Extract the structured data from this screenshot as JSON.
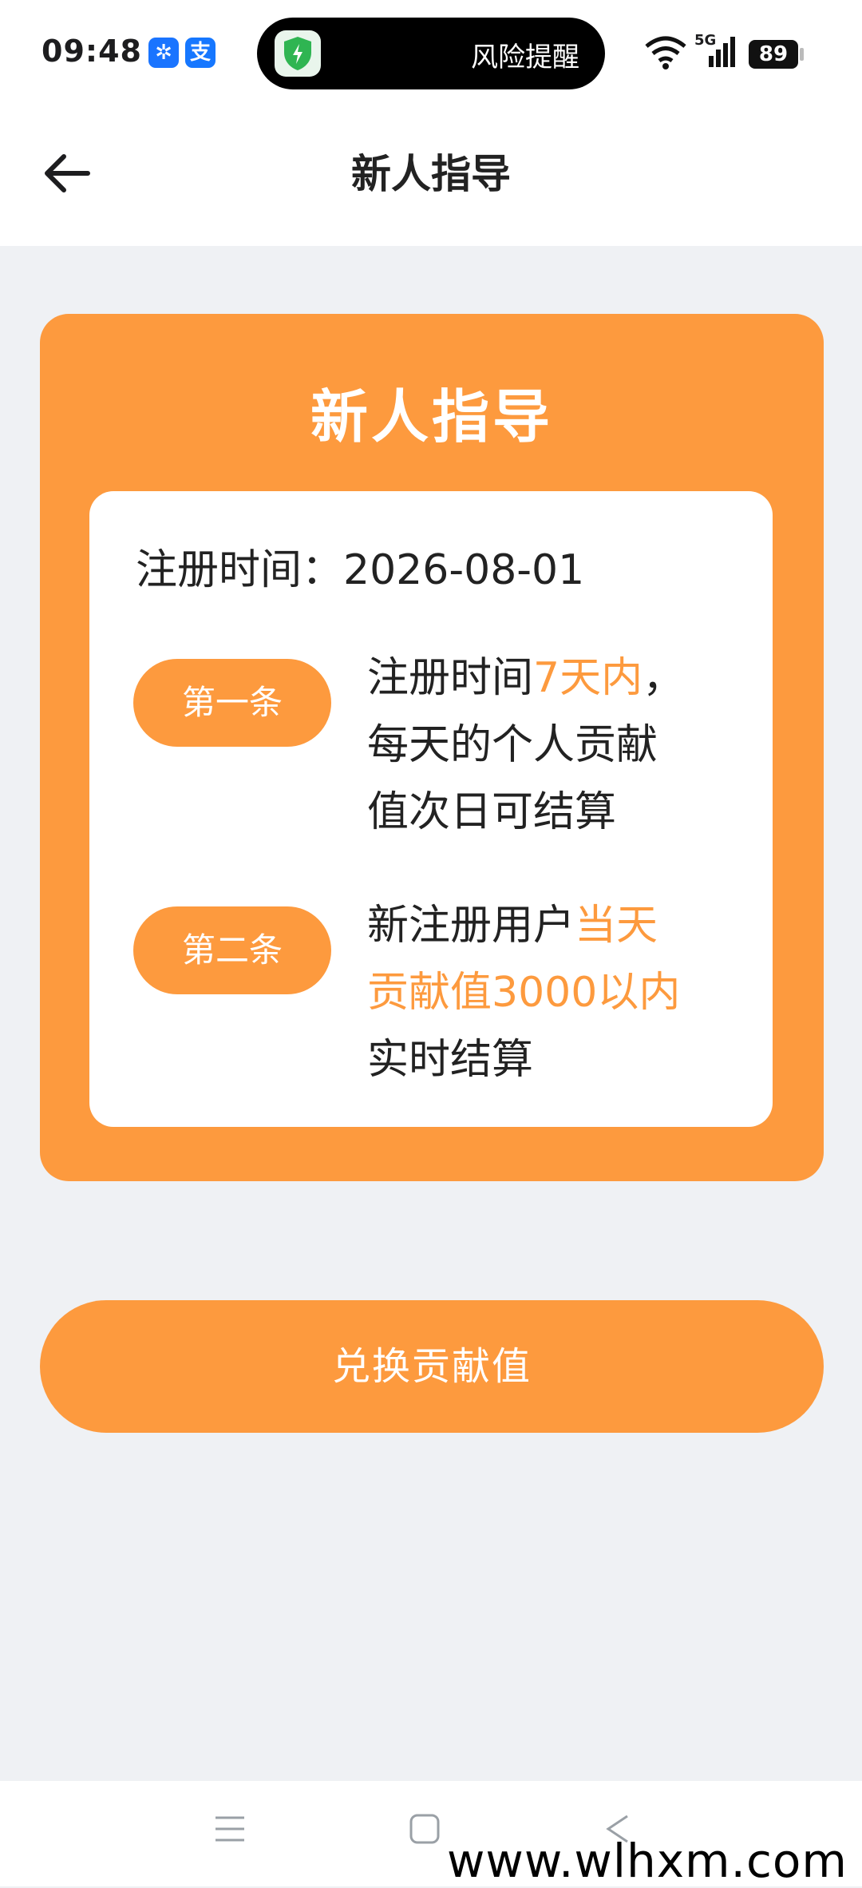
{
  "status_bar": {
    "time": "09:48",
    "app_icon_1": "pinwheel-app-icon",
    "app_icon_2": "支",
    "alert_text": "风险提醒",
    "network": "5G",
    "battery": "89"
  },
  "nav": {
    "title": "新人指导"
  },
  "card": {
    "title": "新人指导",
    "register_label": "注册时间：",
    "register_date": "2026-08-01",
    "rules": [
      {
        "badge": "第一条",
        "line1_a": "注册时间",
        "line1_hl": "7天内",
        "line1_b": "，",
        "line2": "每天的个人贡献",
        "line3": "值次日可结算"
      },
      {
        "badge": "第二条",
        "line1_a": "新注册用户",
        "line1_hl": "当天",
        "line2_hl": "贡献值3000以内",
        "line3": "实时结算"
      }
    ]
  },
  "action": {
    "button_label": "兑换贡献值"
  },
  "watermark": "www.wlhxm.com",
  "colors": {
    "accent": "#fd9a3e",
    "background": "#eff1f4"
  }
}
